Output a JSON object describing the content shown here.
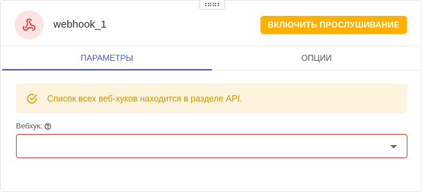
{
  "node": {
    "title": "webhook_1",
    "listen_button_label": "ВКЛЮЧИТЬ ПРОСЛУШИВАНИЕ",
    "icon": "webhook-icon"
  },
  "tabs": [
    {
      "label": "ПАРАМЕТРЫ",
      "active": true
    },
    {
      "label": "ОПЦИИ",
      "active": false
    }
  ],
  "notice": {
    "text": "Список всех веб-хуков находится в разделе API.",
    "icon": "check-circle-icon"
  },
  "webhook_field": {
    "label": "Вебхук:",
    "value": "",
    "help_icon": "help-circle-icon"
  },
  "colors": {
    "accent": "#ffb000",
    "tab_active": "#4756c2",
    "avatar_bg": "#fde3e3",
    "webhook_icon": "#e0464f",
    "notice_bg": "#fdf3de",
    "notice_text": "#c99500",
    "error_border": "#d23a3a"
  }
}
